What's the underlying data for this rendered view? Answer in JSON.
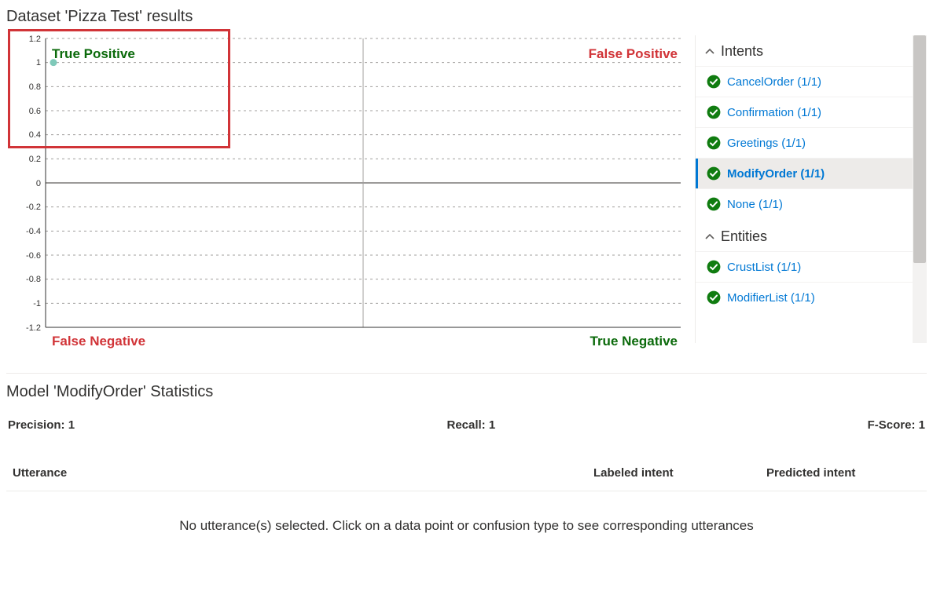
{
  "dataset_title": "Dataset 'Pizza Test' results",
  "chart_data": {
    "type": "scatter",
    "title": "",
    "xlabel": "",
    "ylabel": "",
    "xlim": [
      0,
      100
    ],
    "ylim": [
      -1.2,
      1.2
    ],
    "yticks": [
      -1.2,
      -1,
      -0.8,
      -0.6,
      -0.4,
      -0.2,
      0,
      0.2,
      0.4,
      0.6,
      0.8,
      1,
      1.2
    ],
    "series": [
      {
        "name": "ModifyOrder",
        "x": [
          2
        ],
        "y": [
          1
        ]
      }
    ],
    "quadrant_labels": {
      "top_left": "True Positive",
      "top_right": "False Positive",
      "bottom_left": "False Negative",
      "bottom_right": "True Negative"
    }
  },
  "sidebar": {
    "intents_header": "Intents",
    "entities_header": "Entities",
    "intents": [
      {
        "label": "CancelOrder (1/1)",
        "status": "ok"
      },
      {
        "label": "Confirmation (1/1)",
        "status": "ok"
      },
      {
        "label": "Greetings (1/1)",
        "status": "ok"
      },
      {
        "label": "ModifyOrder (1/1)",
        "status": "ok",
        "selected": true
      },
      {
        "label": "None (1/1)",
        "status": "ok"
      }
    ],
    "entities": [
      {
        "label": "CrustList (1/1)",
        "status": "ok"
      },
      {
        "label": "ModifierList (1/1)",
        "status": "ok"
      }
    ]
  },
  "stats": {
    "title": "Model 'ModifyOrder' Statistics",
    "precision_label": "Precision: 1",
    "recall_label": "Recall: 1",
    "fscore_label": "F-Score: 1"
  },
  "table": {
    "col_utterance": "Utterance",
    "col_labeled": "Labeled intent",
    "col_predicted": "Predicted intent",
    "empty_msg": "No utterance(s) selected. Click on a data point or confusion type to see corresponding utterances"
  }
}
